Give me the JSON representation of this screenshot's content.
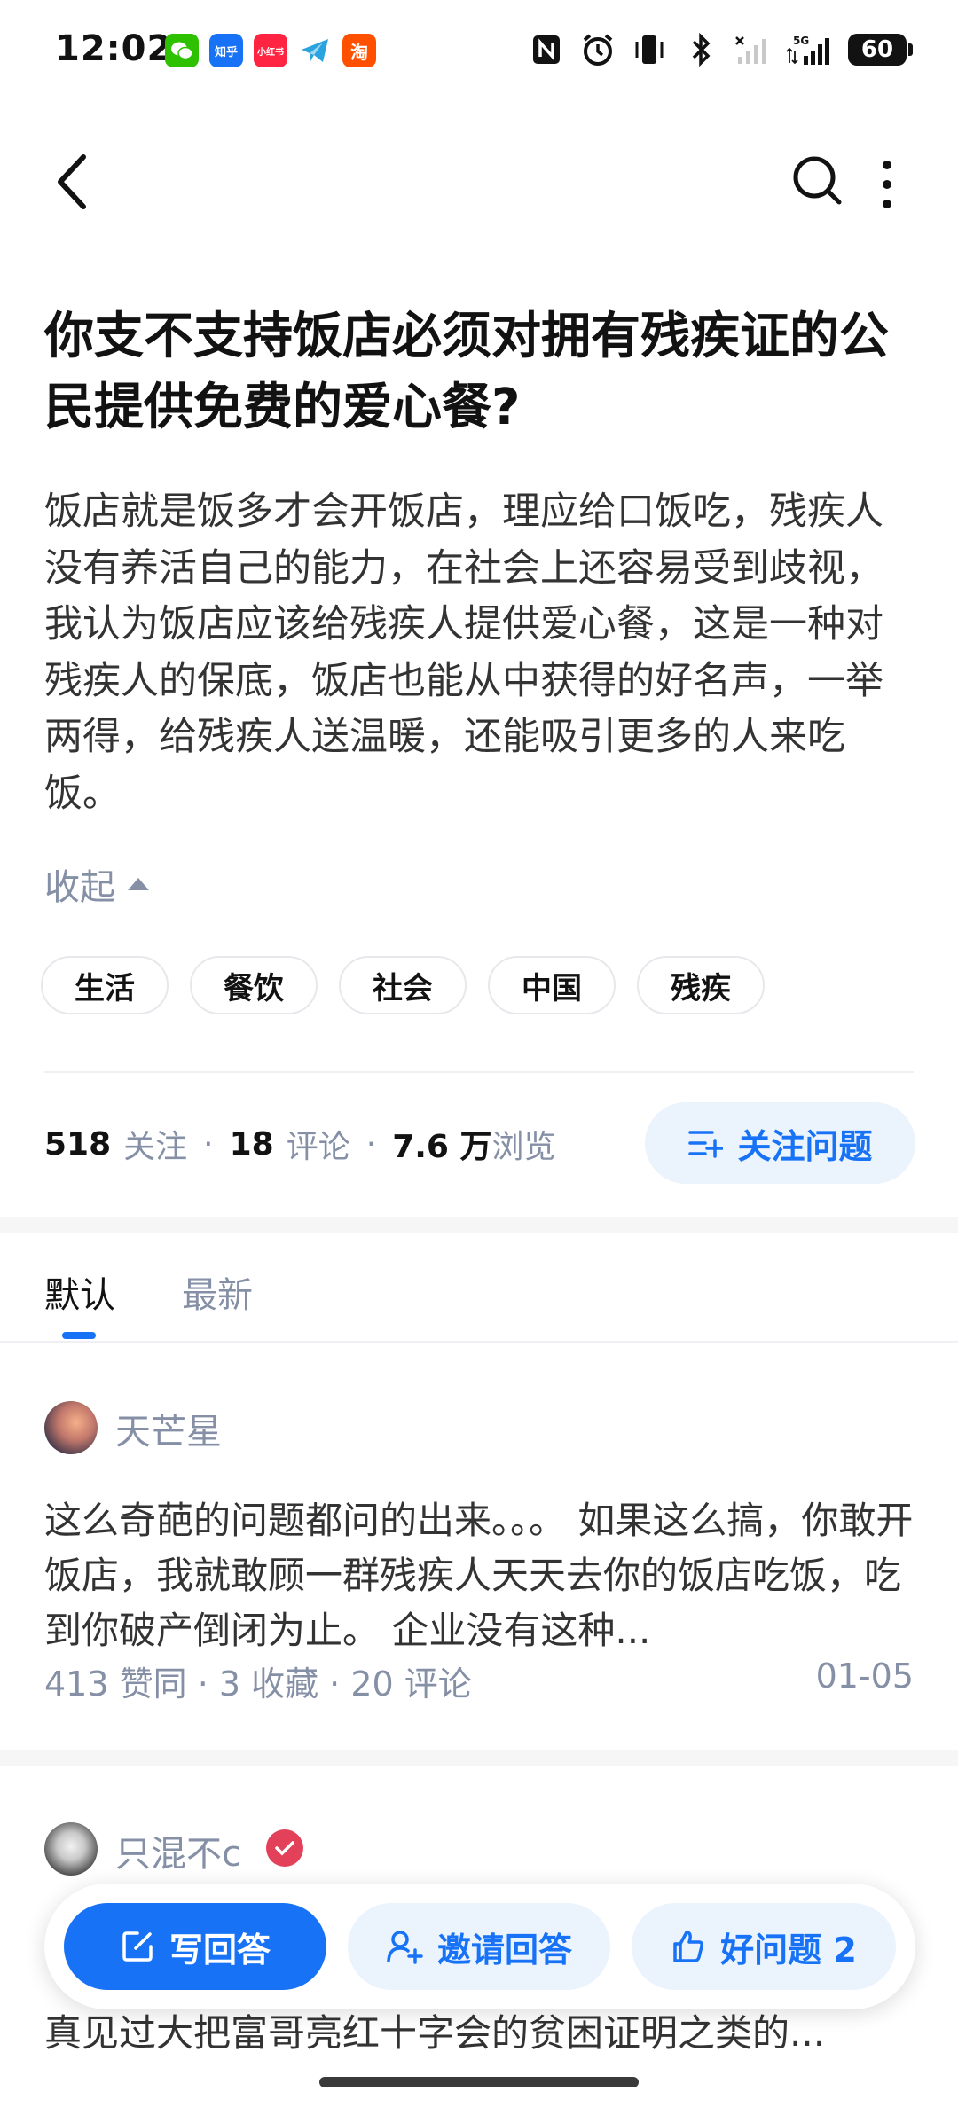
{
  "status_bar": {
    "time": "12:02",
    "apps": [
      {
        "icon": "wechat-icon",
        "label": "",
        "color": "#2dc100"
      },
      {
        "icon": "zhihu-icon",
        "label": "知乎",
        "color": "#1772f6"
      },
      {
        "icon": "xiaohongshu-icon",
        "label": "小红书",
        "color": "#ff2442"
      },
      {
        "icon": "telegram-icon",
        "label": "",
        "color": "#2aa3df"
      },
      {
        "icon": "taobao-icon",
        "label": "淘",
        "color": "#ff5000"
      }
    ],
    "network": "5G",
    "battery": "60"
  },
  "question": {
    "title": "你支不支持饭店必须对拥有残疾证的公民提供免费的爱心餐?",
    "body": "饭店就是饭多才会开饭店，理应给口饭吃，残疾人没有养活自己的能力，在社会上还容易受到歧视，我认为饭店应该给残疾人提供爱心餐，这是一种对残疾人的保底，饭店也能从中获得的好名声，一举两得，给残疾人送温暖，还能吸引更多的人来吃饭。",
    "collapse_label": "收起",
    "tags": [
      "生活",
      "餐饮",
      "社会",
      "中国",
      "残疾"
    ],
    "stats": {
      "followers": "518",
      "followers_label": "关注",
      "comments": "18",
      "comments_label": "评论",
      "views": "7.6 万",
      "views_label": "浏览"
    },
    "follow_button": "关注问题"
  },
  "tabs": [
    {
      "label": "默认",
      "active": true
    },
    {
      "label": "最新",
      "active": false
    }
  ],
  "answers": [
    {
      "author": "天芒星",
      "text": "这么奇葩的问题都问的出来。。。 如果这么搞，你敢开饭店，我就敢顾一群残疾人天天去你的饭店吃饭，吃到你破产倒闭为止。 企业没有这种...",
      "meta": "413 赞同 · 3 收藏 · 20 评论",
      "date": "01-05"
    },
    {
      "author": "只混不c",
      "text": "真见过大把富哥亮红十字会的贫困证明之类的..."
    }
  ],
  "action_bar": {
    "write": "写回答",
    "invite": "邀请回答",
    "good": "好问题 2"
  },
  "colors": {
    "accent": "#1772f6",
    "accent_light": "#ebf3fd",
    "muted": "#8590a6"
  }
}
